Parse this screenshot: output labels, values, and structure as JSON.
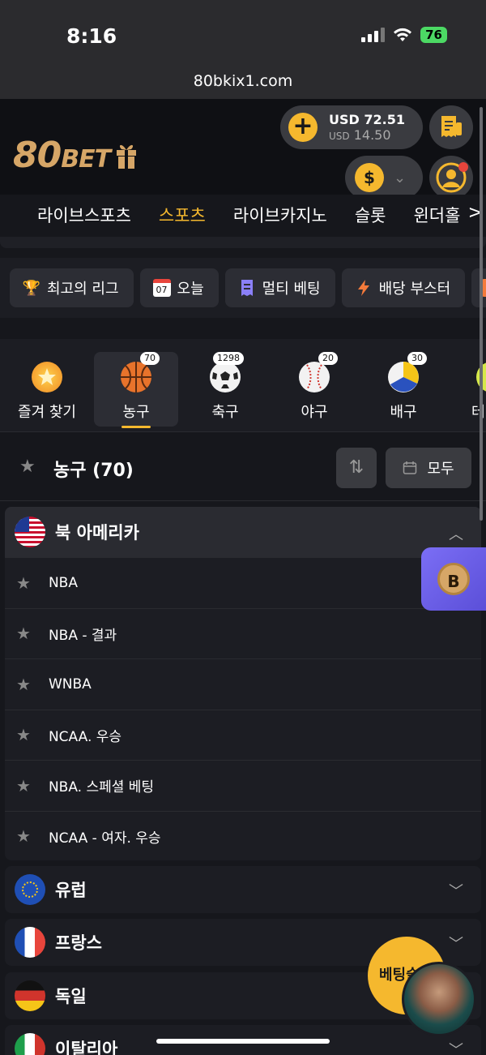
{
  "status": {
    "time": "8:16",
    "battery": "76"
  },
  "url": "80bkix1.com",
  "header": {
    "logo_main": "80",
    "logo_sub": "BET",
    "balance_main": "USD 72.51",
    "balance_sub_currency": "USD",
    "balance_sub_value": "14.50",
    "currency_symbol": "$"
  },
  "mainnav": {
    "items": [
      "라이브스포츠",
      "스포츠",
      "라이브카지노",
      "슬롯",
      "윈더홀"
    ],
    "active_index": 1,
    "more": ">"
  },
  "chips": [
    {
      "label": "최고의 리그",
      "icon": "trophy-icon"
    },
    {
      "label": "오늘",
      "icon": "calendar-icon",
      "date": "07"
    },
    {
      "label": "멀티 베팅",
      "icon": "ticket-icon"
    },
    {
      "label": "배당 부스터",
      "icon": "boost-icon"
    }
  ],
  "sports": [
    {
      "label": "즐겨 찾기",
      "icon": "star-icon",
      "count": ""
    },
    {
      "label": "농구",
      "icon": "basketball-icon",
      "count": "70"
    },
    {
      "label": "축구",
      "icon": "soccer-ball-icon",
      "count": "1298"
    },
    {
      "label": "야구",
      "icon": "baseball-icon",
      "count": "20"
    },
    {
      "label": "배구",
      "icon": "volleyball-icon",
      "count": "30"
    },
    {
      "label": "테",
      "icon": "tennis-ball-icon",
      "count": ""
    }
  ],
  "section": {
    "title": "농구 (70)",
    "all_label": "모두"
  },
  "region_open": {
    "name": "북 아메리카",
    "leagues": [
      "NBA",
      "NBA - 결과",
      "WNBA",
      "NCAA. 우승",
      "NBA. 스페셜 베팅",
      "NCAA - 여자. 우승"
    ]
  },
  "regions": [
    "유럽",
    "프랑스",
    "독일",
    "이탈리아"
  ],
  "floating": {
    "bonus": "B",
    "betslip": "베팅슬"
  },
  "colors": {
    "accent": "#f5b82e",
    "background": "#16171c",
    "panel": "#1c1d23"
  }
}
